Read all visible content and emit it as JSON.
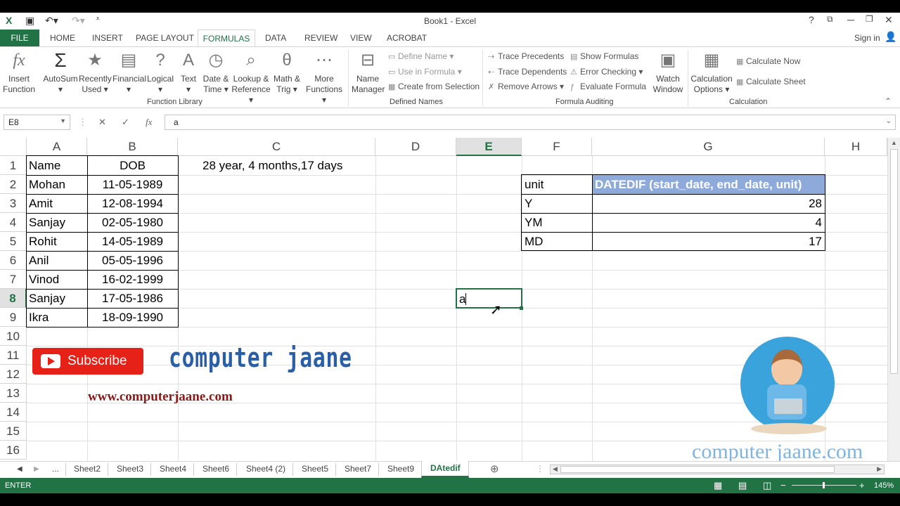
{
  "window": {
    "title": "Book1 - Excel",
    "signin": "Sign in"
  },
  "ribbon_tabs": {
    "file": "FILE",
    "home": "HOME",
    "insert": "INSERT",
    "page_layout": "PAGE LAYOUT",
    "formulas": "FORMULAS",
    "data": "DATA",
    "review": "REVIEW",
    "view": "VIEW",
    "acrobat": "ACROBAT"
  },
  "ribbon": {
    "insert_function": [
      "Insert",
      "Function"
    ],
    "autosum": "AutoSum",
    "recently_used": [
      "Recently",
      "Used ▾"
    ],
    "financial": "Financial",
    "logical": "Logical",
    "text": "Text",
    "date_time": [
      "Date &",
      "Time ▾"
    ],
    "lookup": [
      "Lookup &",
      "Reference ▾"
    ],
    "math": [
      "Math &",
      "Trig ▾"
    ],
    "more": [
      "More",
      "Functions ▾"
    ],
    "function_library": "Function Library",
    "name_manager": [
      "Name",
      "Manager"
    ],
    "define_name": "Define Name ▾",
    "use_in_formula": "Use in Formula ▾",
    "create_from_selection": "Create from Selection",
    "defined_names": "Defined Names",
    "trace_precedents": "Trace Precedents",
    "trace_dependents": "Trace Dependents",
    "remove_arrows": "Remove Arrows ▾",
    "show_formulas": "Show Formulas",
    "error_checking": "Error Checking ▾",
    "evaluate_formula": "Evaluate Formula",
    "watch_window": [
      "Watch",
      "Window"
    ],
    "formula_auditing": "Formula Auditing",
    "calc_options": [
      "Calculation",
      "Options ▾"
    ],
    "calc_now": "Calculate Now",
    "calc_sheet": "Calculate Sheet",
    "calculation": "Calculation"
  },
  "formula_bar": {
    "name_box": "E8",
    "value": "a"
  },
  "columns": [
    "A",
    "B",
    "C",
    "D",
    "E",
    "F",
    "G",
    "H"
  ],
  "rows": [
    "1",
    "2",
    "3",
    "4",
    "5",
    "6",
    "7",
    "8",
    "9",
    "10",
    "11",
    "12",
    "13",
    "14",
    "15",
    "16"
  ],
  "sheet": {
    "a1": "Name",
    "b1": "DOB",
    "c1": "28 year, 4 months,17 days",
    "names": [
      "Mohan",
      "Amit",
      "Sanjay",
      "Rohit",
      "Anil",
      "Vinod",
      "Sanjay",
      "Ikra"
    ],
    "dobs": [
      "11-05-1989",
      "12-08-1994",
      "02-05-1980",
      "14-05-1989",
      "05-05-1996",
      "16-02-1999",
      "17-05-1986",
      "18-09-1990"
    ],
    "f2": "unit",
    "g2": "DATEDIF (start_date, end_date, unit)",
    "units": [
      "Y",
      "YM",
      "MD"
    ],
    "results": [
      "28",
      "4",
      "17"
    ],
    "e8": "a"
  },
  "overlay": {
    "subscribe": "Subscribe",
    "brand": "computer jaane",
    "site": "www.computerjaane.com",
    "watermark": "computer jaane.com"
  },
  "sheet_tabs": [
    "...",
    "Sheet2",
    "Sheet3",
    "Sheet4",
    "Sheet6",
    "Sheet4 (2)",
    "Sheet5",
    "Sheet7",
    "Sheet9",
    "DAtedif"
  ],
  "status": {
    "mode": "ENTER",
    "zoom": "145%"
  },
  "colors": {
    "excel_green": "#217346",
    "header_fill": "#8eaadb"
  }
}
